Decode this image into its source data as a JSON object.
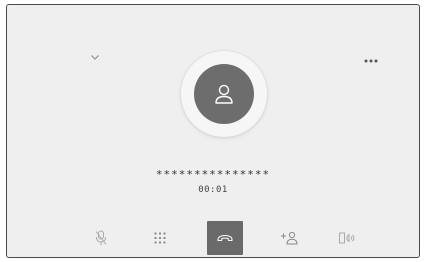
{
  "call": {
    "number": "***************",
    "duration": "00:01"
  },
  "controls": {
    "collapse": {
      "icon": "chevron-down-icon"
    },
    "more": {
      "icon": "more-horizontal-icon"
    },
    "mute": {
      "icon": "mic-off-icon"
    },
    "keypad": {
      "icon": "keypad-icon"
    },
    "end_call": {
      "icon": "phone-hangup-icon"
    },
    "add_call": {
      "icon": "add-person-icon"
    },
    "handsfree": {
      "icon": "phone-speaker-icon"
    }
  },
  "colors": {
    "background": "#efefef",
    "avatar": "#6d6d6d",
    "end_call_button": "#6a6a6a"
  }
}
